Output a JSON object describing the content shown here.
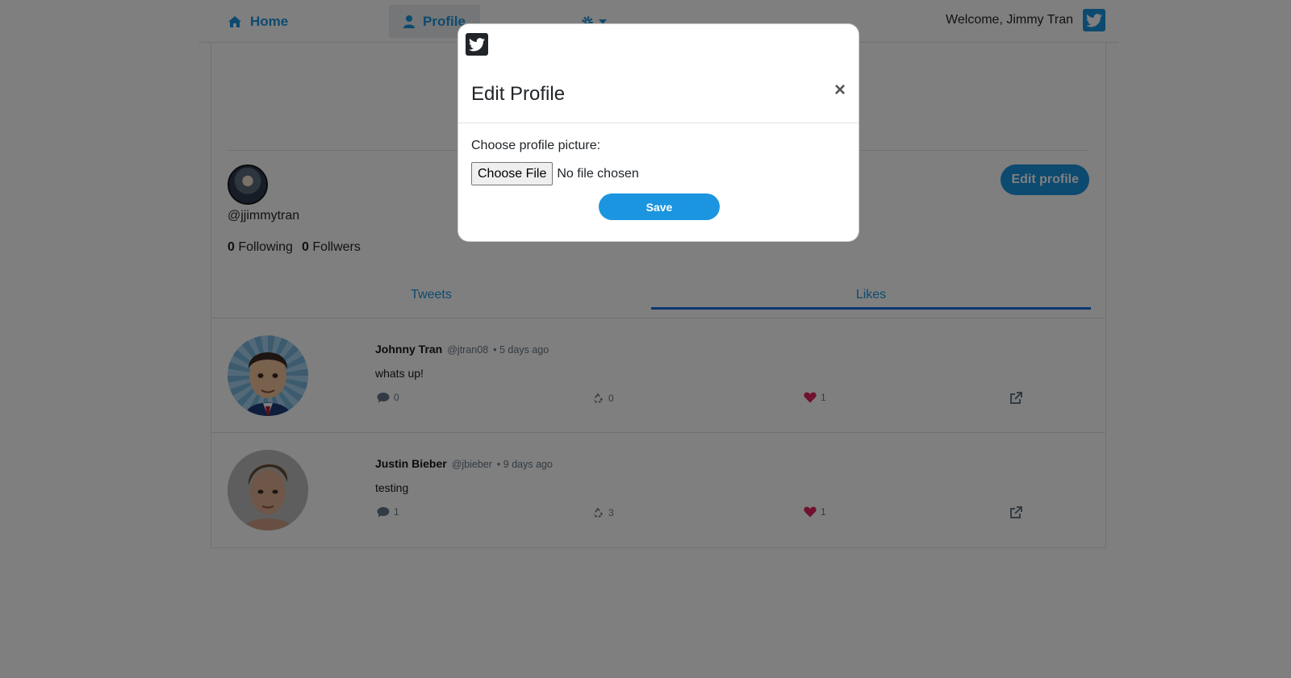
{
  "nav": {
    "home_label": "Home",
    "profile_label": "Profile",
    "welcome_text": "Welcome, Jimmy Tran",
    "icons": [
      "home-icon",
      "user-icon",
      "gear-icon",
      "caret-down-icon",
      "twitter-icon"
    ]
  },
  "profile": {
    "handle": "@jjimmytran",
    "following_count": "0",
    "following_label": "Following",
    "followers_count": "0",
    "followers_label": "Follwers",
    "edit_button_label": "Edit profile"
  },
  "tabs": [
    {
      "label": "Tweets",
      "active": false
    },
    {
      "label": "Likes",
      "active": true
    }
  ],
  "tweets": [
    {
      "name": "Johnny Tran",
      "handle": "@jtran08",
      "time": "• 5 days ago",
      "text": "whats up!",
      "replies": "0",
      "retweets": "0",
      "likes": "1"
    },
    {
      "name": "Justin Bieber",
      "handle": "@jbieber",
      "time": "• 9 days ago",
      "text": "testing",
      "replies": "1",
      "retweets": "3",
      "likes": "1"
    }
  ],
  "modal": {
    "title": "Edit Profile",
    "close_symbol": "×",
    "picture_label": "Choose profile picture:",
    "file_button_label": "Choose File",
    "file_status": "No file chosen",
    "save_label": "Save"
  },
  "colors": {
    "accent": "#1b95e0",
    "like_red": "#e0245e",
    "overlay": "rgba(0,0,0,0.5)"
  }
}
